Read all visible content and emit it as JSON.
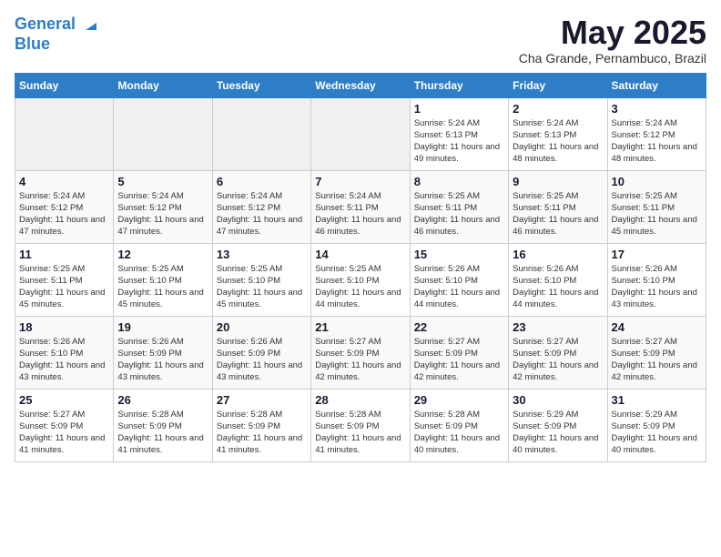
{
  "header": {
    "logo_line1": "General",
    "logo_line2": "Blue",
    "month_title": "May 2025",
    "location": "Cha Grande, Pernambuco, Brazil"
  },
  "weekdays": [
    "Sunday",
    "Monday",
    "Tuesday",
    "Wednesday",
    "Thursday",
    "Friday",
    "Saturday"
  ],
  "weeks": [
    [
      {
        "day": "",
        "empty": true
      },
      {
        "day": "",
        "empty": true
      },
      {
        "day": "",
        "empty": true
      },
      {
        "day": "",
        "empty": true
      },
      {
        "day": "1",
        "sunrise": "5:24 AM",
        "sunset": "5:13 PM",
        "daylight": "11 hours and 49 minutes."
      },
      {
        "day": "2",
        "sunrise": "5:24 AM",
        "sunset": "5:13 PM",
        "daylight": "11 hours and 48 minutes."
      },
      {
        "day": "3",
        "sunrise": "5:24 AM",
        "sunset": "5:12 PM",
        "daylight": "11 hours and 48 minutes."
      }
    ],
    [
      {
        "day": "4",
        "sunrise": "5:24 AM",
        "sunset": "5:12 PM",
        "daylight": "11 hours and 47 minutes."
      },
      {
        "day": "5",
        "sunrise": "5:24 AM",
        "sunset": "5:12 PM",
        "daylight": "11 hours and 47 minutes."
      },
      {
        "day": "6",
        "sunrise": "5:24 AM",
        "sunset": "5:12 PM",
        "daylight": "11 hours and 47 minutes."
      },
      {
        "day": "7",
        "sunrise": "5:24 AM",
        "sunset": "5:11 PM",
        "daylight": "11 hours and 46 minutes."
      },
      {
        "day": "8",
        "sunrise": "5:25 AM",
        "sunset": "5:11 PM",
        "daylight": "11 hours and 46 minutes."
      },
      {
        "day": "9",
        "sunrise": "5:25 AM",
        "sunset": "5:11 PM",
        "daylight": "11 hours and 46 minutes."
      },
      {
        "day": "10",
        "sunrise": "5:25 AM",
        "sunset": "5:11 PM",
        "daylight": "11 hours and 45 minutes."
      }
    ],
    [
      {
        "day": "11",
        "sunrise": "5:25 AM",
        "sunset": "5:11 PM",
        "daylight": "11 hours and 45 minutes."
      },
      {
        "day": "12",
        "sunrise": "5:25 AM",
        "sunset": "5:10 PM",
        "daylight": "11 hours and 45 minutes."
      },
      {
        "day": "13",
        "sunrise": "5:25 AM",
        "sunset": "5:10 PM",
        "daylight": "11 hours and 45 minutes."
      },
      {
        "day": "14",
        "sunrise": "5:25 AM",
        "sunset": "5:10 PM",
        "daylight": "11 hours and 44 minutes."
      },
      {
        "day": "15",
        "sunrise": "5:26 AM",
        "sunset": "5:10 PM",
        "daylight": "11 hours and 44 minutes."
      },
      {
        "day": "16",
        "sunrise": "5:26 AM",
        "sunset": "5:10 PM",
        "daylight": "11 hours and 44 minutes."
      },
      {
        "day": "17",
        "sunrise": "5:26 AM",
        "sunset": "5:10 PM",
        "daylight": "11 hours and 43 minutes."
      }
    ],
    [
      {
        "day": "18",
        "sunrise": "5:26 AM",
        "sunset": "5:10 PM",
        "daylight": "11 hours and 43 minutes."
      },
      {
        "day": "19",
        "sunrise": "5:26 AM",
        "sunset": "5:09 PM",
        "daylight": "11 hours and 43 minutes."
      },
      {
        "day": "20",
        "sunrise": "5:26 AM",
        "sunset": "5:09 PM",
        "daylight": "11 hours and 43 minutes."
      },
      {
        "day": "21",
        "sunrise": "5:27 AM",
        "sunset": "5:09 PM",
        "daylight": "11 hours and 42 minutes."
      },
      {
        "day": "22",
        "sunrise": "5:27 AM",
        "sunset": "5:09 PM",
        "daylight": "11 hours and 42 minutes."
      },
      {
        "day": "23",
        "sunrise": "5:27 AM",
        "sunset": "5:09 PM",
        "daylight": "11 hours and 42 minutes."
      },
      {
        "day": "24",
        "sunrise": "5:27 AM",
        "sunset": "5:09 PM",
        "daylight": "11 hours and 42 minutes."
      }
    ],
    [
      {
        "day": "25",
        "sunrise": "5:27 AM",
        "sunset": "5:09 PM",
        "daylight": "11 hours and 41 minutes."
      },
      {
        "day": "26",
        "sunrise": "5:28 AM",
        "sunset": "5:09 PM",
        "daylight": "11 hours and 41 minutes."
      },
      {
        "day": "27",
        "sunrise": "5:28 AM",
        "sunset": "5:09 PM",
        "daylight": "11 hours and 41 minutes."
      },
      {
        "day": "28",
        "sunrise": "5:28 AM",
        "sunset": "5:09 PM",
        "daylight": "11 hours and 41 minutes."
      },
      {
        "day": "29",
        "sunrise": "5:28 AM",
        "sunset": "5:09 PM",
        "daylight": "11 hours and 40 minutes."
      },
      {
        "day": "30",
        "sunrise": "5:29 AM",
        "sunset": "5:09 PM",
        "daylight": "11 hours and 40 minutes."
      },
      {
        "day": "31",
        "sunrise": "5:29 AM",
        "sunset": "5:09 PM",
        "daylight": "11 hours and 40 minutes."
      }
    ]
  ]
}
